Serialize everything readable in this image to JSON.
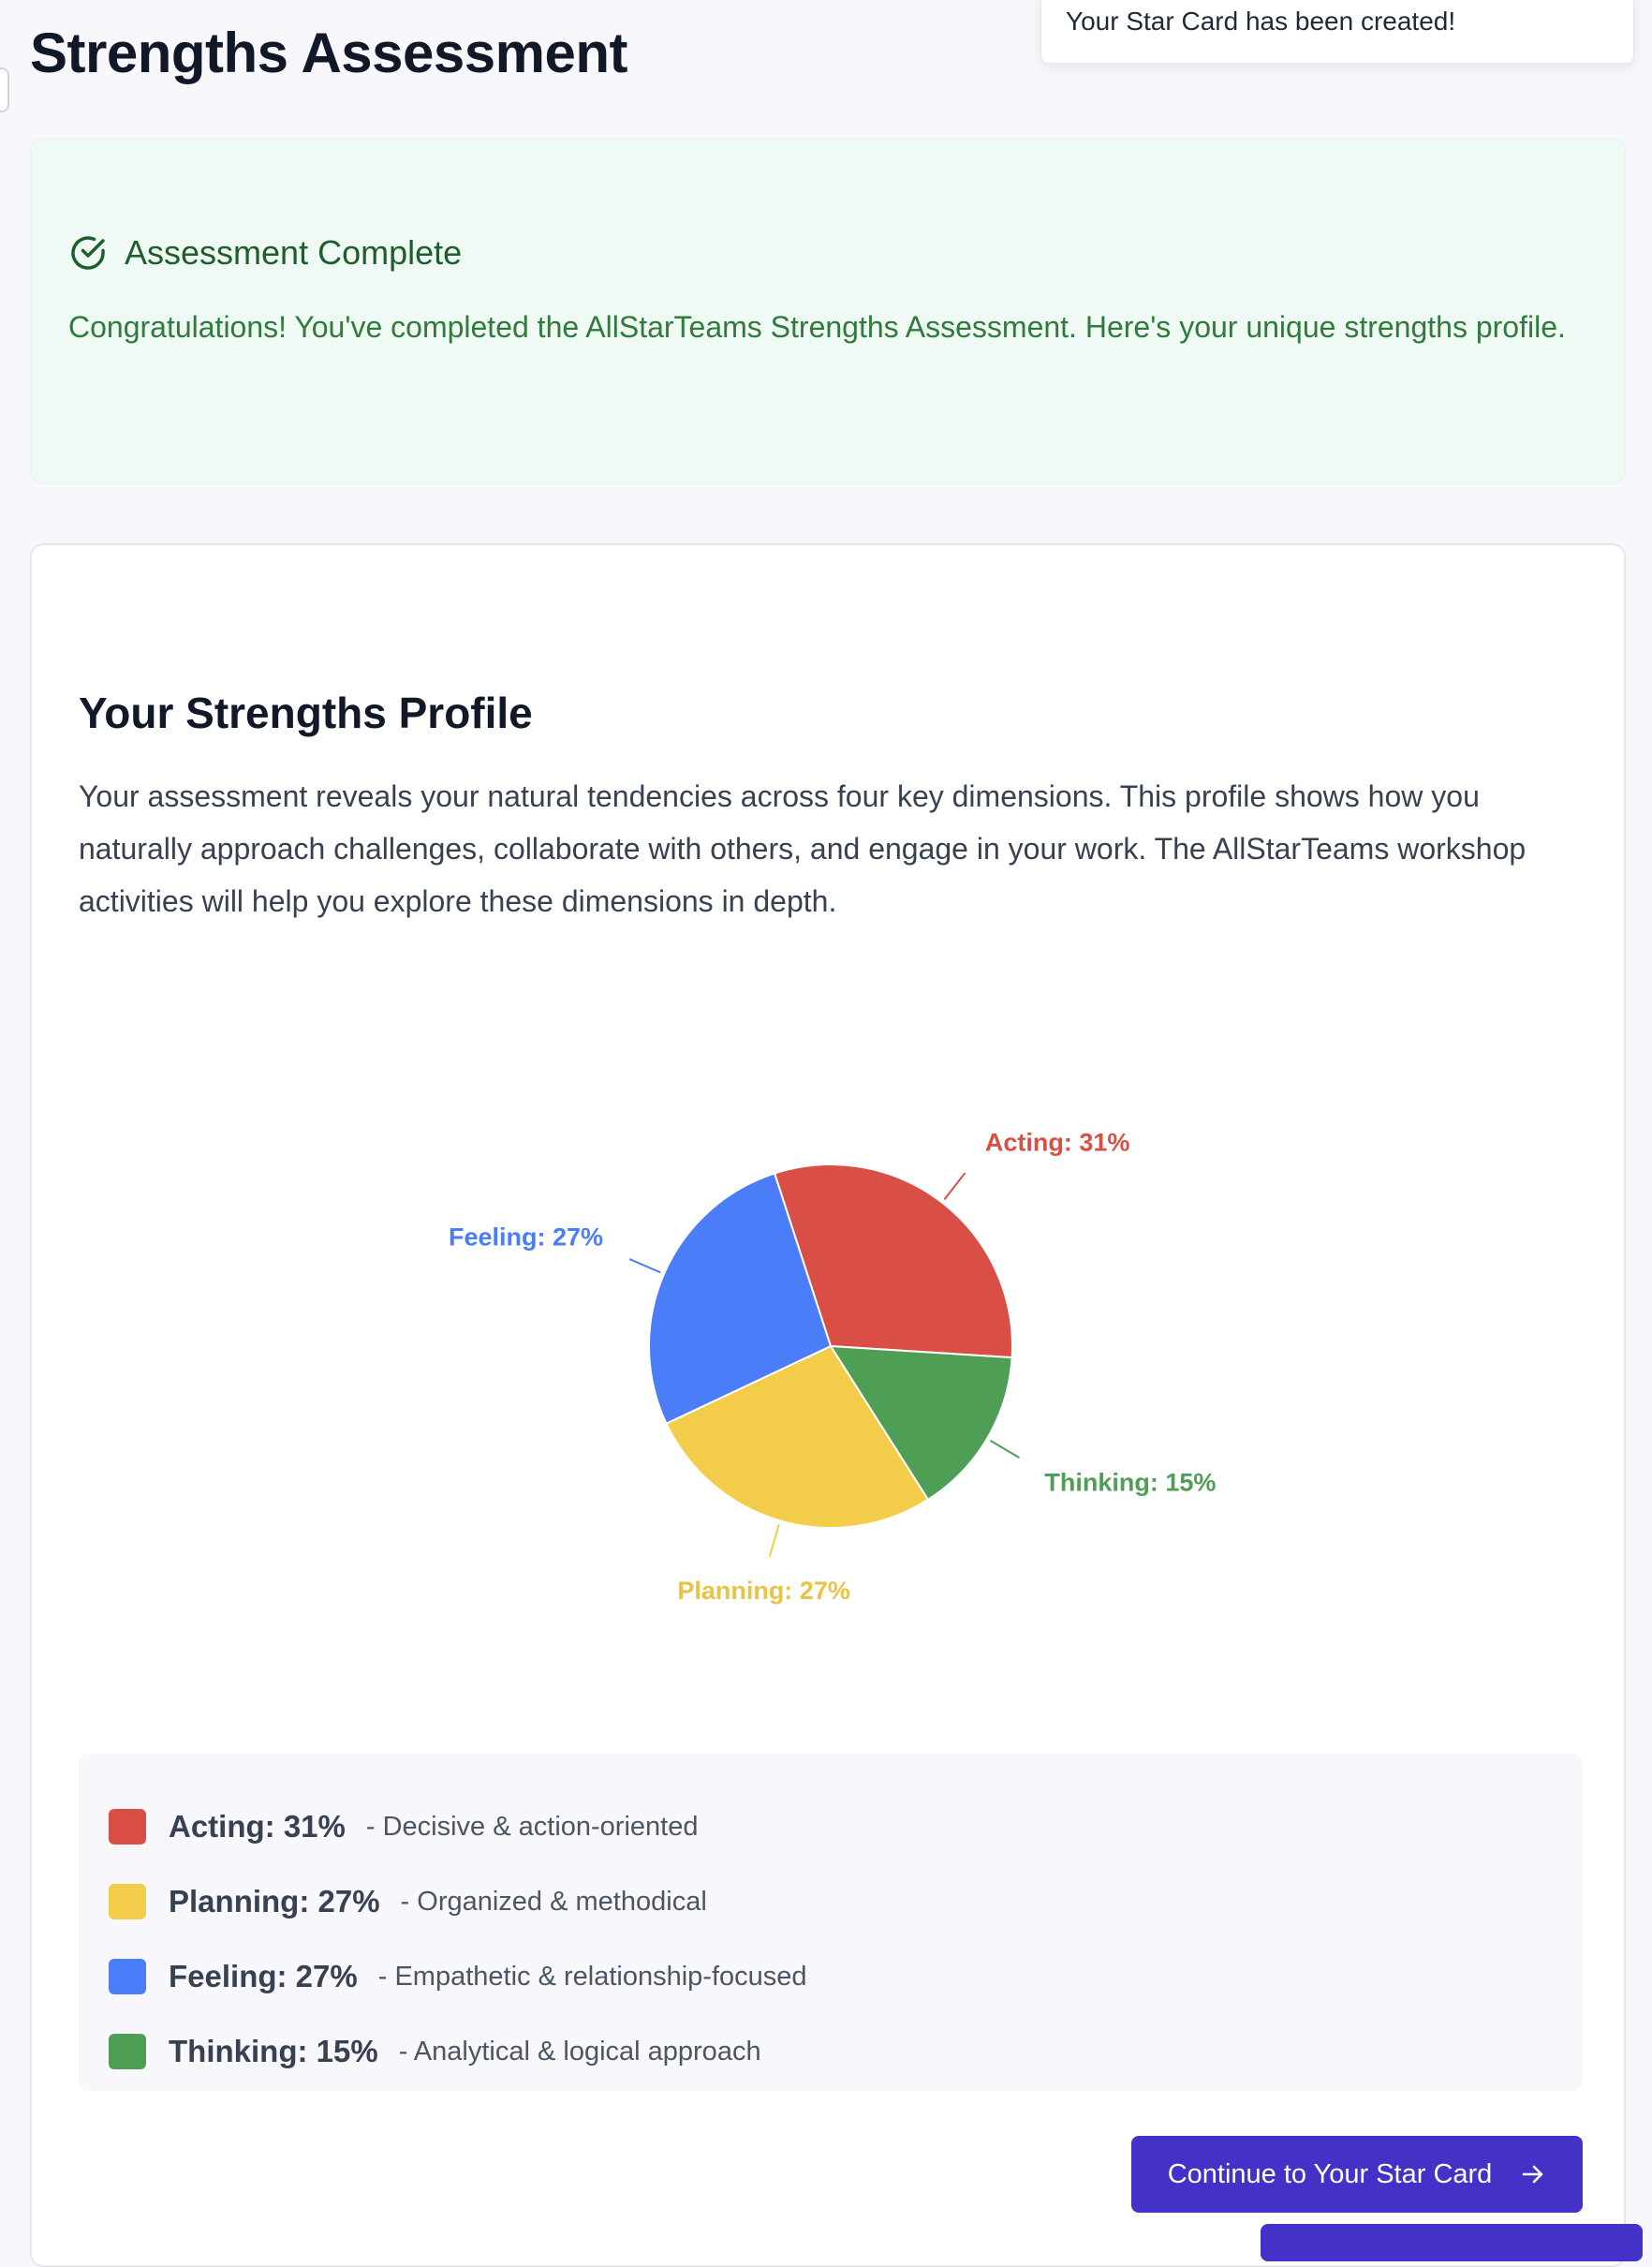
{
  "page": {
    "title": "Strengths Assessment"
  },
  "toast": {
    "message": "Your Star Card has been created!"
  },
  "assessment_complete": {
    "title": "Assessment Complete",
    "message": "Congratulations! You've completed the AllStarTeams Strengths Assessment. Here's your unique strengths profile."
  },
  "profile": {
    "title": "Your Strengths Profile",
    "description": "Your assessment reveals your natural tendencies across four key dimensions. This profile shows how you naturally approach challenges, collaborate with others, and engage in your work. The AllStarTeams workshop activities will help you explore these dimensions in depth."
  },
  "chart_data": {
    "type": "pie",
    "title": "",
    "slices": [
      {
        "name": "Acting",
        "value": 31,
        "color": "#d94f45",
        "label": "Acting: 31%"
      },
      {
        "name": "Thinking",
        "value": 15,
        "color": "#4f9e55",
        "label": "Thinking: 15%"
      },
      {
        "name": "Planning",
        "value": 27,
        "color": "#f3cd4a",
        "label": "Planning: 27%"
      },
      {
        "name": "Feeling",
        "value": 27,
        "color": "#4b7df8",
        "label": "Feeling: 27%"
      }
    ]
  },
  "legend": [
    {
      "label": "Acting: 31%",
      "description": "- Decisive & action-oriented",
      "color": "#d94f45"
    },
    {
      "label": "Planning: 27%",
      "description": "- Organized & methodical",
      "color": "#f3cd4a"
    },
    {
      "label": "Feeling: 27%",
      "description": "- Empathetic & relationship-focused",
      "color": "#4b7df8"
    },
    {
      "label": "Thinking: 15%",
      "description": "- Analytical & logical approach",
      "color": "#4f9e55"
    }
  ],
  "actions": {
    "continue_label": "Continue to Your Star Card"
  },
  "icons": {
    "check": "check-circle-icon",
    "arrow": "arrow-right-icon"
  }
}
